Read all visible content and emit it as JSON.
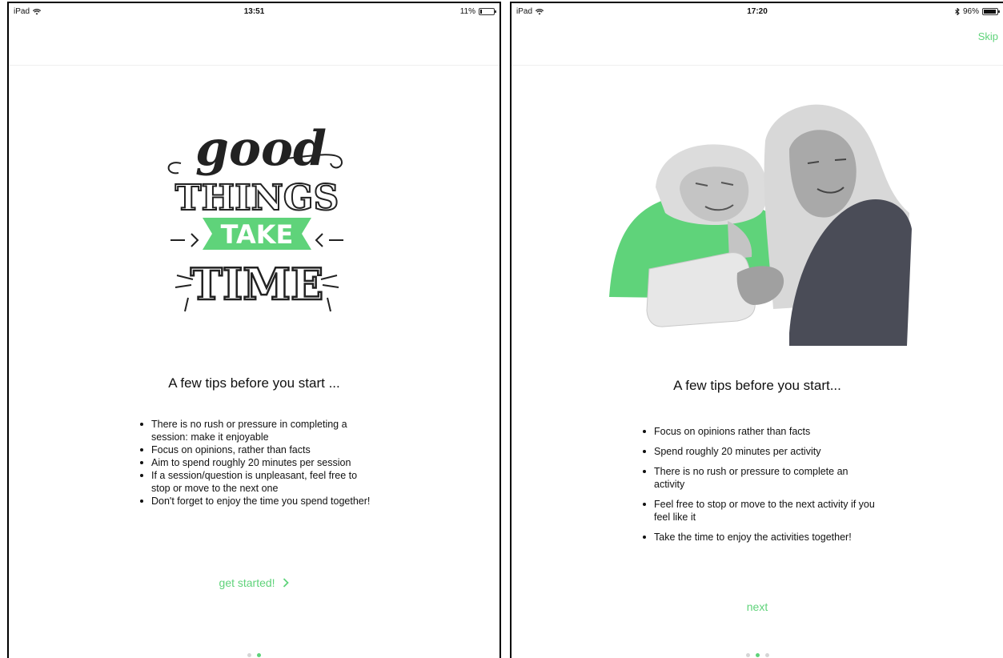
{
  "colors": {
    "accent": "#5fd37a",
    "text": "#111111",
    "inactive_dot": "#d6d6d6"
  },
  "left": {
    "status": {
      "device": "iPad",
      "time": "13:51",
      "battery_text": "11%",
      "battery_level": 0.11
    },
    "artwork": {
      "word1": "good",
      "word2": "THINGS",
      "word3": "TAKE",
      "word4": "TIME"
    },
    "heading": "A few tips before you start ...",
    "tips": [
      "There is no rush or pressure in completing a session: make it enjoyable",
      "Focus on opinions, rather than facts",
      "Aim to spend roughly 20 minutes per session",
      "If a session/question is unpleasant, feel free to stop or move to the next one",
      "Don't forget to enjoy the time you spend together!"
    ],
    "cta_label": "get started!",
    "cta_icon": "chevron-right-icon",
    "page_indicator": {
      "count": 2,
      "active": 2
    }
  },
  "right": {
    "status": {
      "device": "iPad",
      "time": "17:20",
      "battery_text": "96%",
      "battery_level": 0.96,
      "bluetooth_icon": "bluetooth-icon"
    },
    "skip_label": "Skip",
    "illustration_icon": "elderly-man-and-woman-with-tablet-illustration",
    "heading": "A few tips before you start...",
    "tips": [
      "Focus on opinions rather than facts",
      "Spend roughly 20 minutes per activity",
      "There is no rush or pressure to complete an activity",
      "Feel free to stop or move to the next activity if you feel like it",
      "Take the time to enjoy the activities together!"
    ],
    "cta_label": "next",
    "page_indicator": {
      "count": 3,
      "active": 2
    }
  }
}
